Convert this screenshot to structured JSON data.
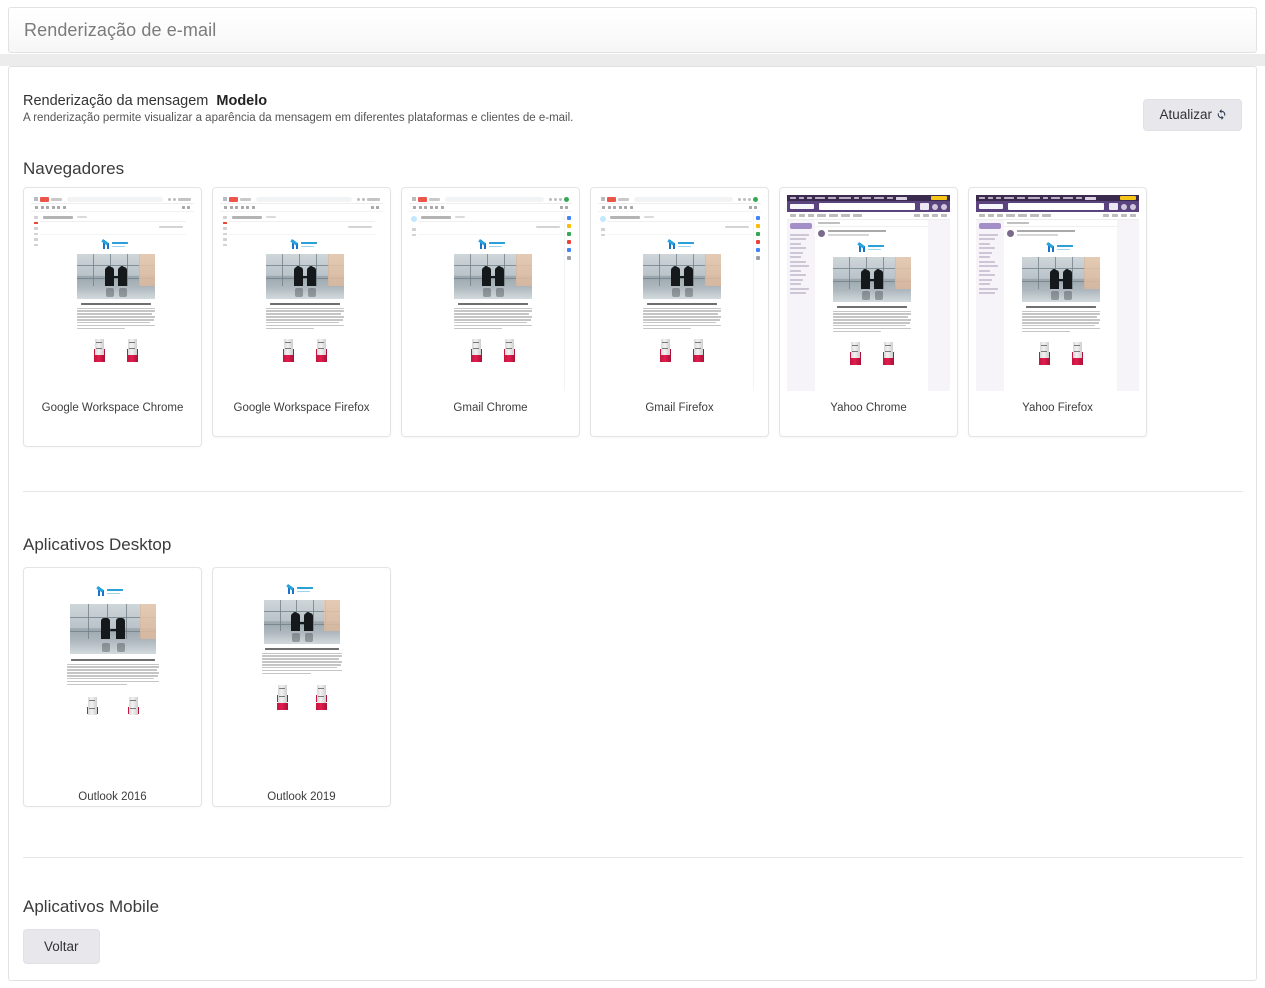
{
  "window": {
    "title": "Renderização de e-mail"
  },
  "intro": {
    "heading": "Renderização da mensagem",
    "heading_strong": "Modelo",
    "description": "A renderização permite visualizar a aparência da mensagem em diferentes plataformas e clientes de e-mail.",
    "refresh_label": "Atualizar",
    "refresh_icon": "refresh-icon"
  },
  "sections": [
    {
      "id": "browsers",
      "title": "Navegadores"
    },
    {
      "id": "desktop",
      "title": "Aplicativos Desktop"
    },
    {
      "id": "mobile",
      "title": "Aplicativos Mobile"
    }
  ],
  "browser_cards": [
    {
      "label": "Google Workspace Chrome",
      "client": "gmail",
      "browser": "chrome"
    },
    {
      "label": "Google Workspace Firefox",
      "client": "gmail",
      "browser": "firefox"
    },
    {
      "label": "Gmail Chrome",
      "client": "gmail",
      "browser": "chrome"
    },
    {
      "label": "Gmail Firefox",
      "client": "gmail",
      "browser": "firefox"
    },
    {
      "label": "Yahoo Chrome",
      "client": "yahoo",
      "browser": "chrome"
    },
    {
      "label": "Yahoo Firefox",
      "client": "yahoo",
      "browser": "firefox"
    }
  ],
  "desktop_cards": [
    {
      "label": "Outlook 2016",
      "client": "outlook"
    },
    {
      "label": "Outlook 2019",
      "client": "outlook"
    }
  ],
  "footer": {
    "back_label": "Voltar"
  },
  "colors": {
    "page_background": "#ececec",
    "card_background": "#ffffff",
    "card_border": "#e4e4e4",
    "title_text": "#7b7b7b",
    "button_background": "#e8e8ec",
    "yahoo_header": "#5b4380",
    "yahoo_topbar": "#3a2a4d",
    "yahoo_accent": "#f5c518",
    "gmail_red": "#ea4335",
    "logo_blue": "#1a73c7",
    "wine_label": "#c2163f"
  }
}
